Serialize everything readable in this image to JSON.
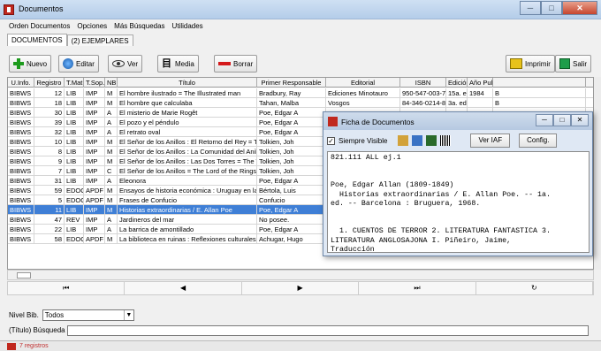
{
  "window": {
    "title": "Documentos"
  },
  "menu": [
    "Orden Documentos",
    "Opciones",
    "Más Búsquedas",
    "Utilidades"
  ],
  "tabs": [
    "DOCUMENTOS",
    "(2) EJEMPLARES"
  ],
  "toolbar": {
    "nuevo": "Nuevo",
    "editar": "Editar",
    "ver": "Ver",
    "media": "Media",
    "borrar": "Borrar",
    "imprimir": "Imprimir",
    "salir": "Salir"
  },
  "table": {
    "headers": [
      "U.Info.",
      "Registro",
      "T.Mat.",
      "T.Sop.",
      "NB.",
      "Título",
      "Primer Responsable",
      "Editorial",
      "ISBN",
      "Edición",
      "Año Pub.",
      ""
    ],
    "rows": [
      [
        "BIBWS",
        "12",
        "LIB",
        "IMP",
        "M",
        "El hombre ilustrado = The Illustrated man",
        "Bradbury, Ray",
        "Ediciones Minotauro",
        "950-547-003-7",
        "15a. ed.",
        "1984",
        "B"
      ],
      [
        "BIBWS",
        "18",
        "LIB",
        "IMP",
        "M",
        "El hombre que calculaba",
        "Tahan, Malba",
        "Vosgos",
        "84-346-0214-8",
        "3a. ed.",
        "",
        "B"
      ],
      [
        "BIBWS",
        "30",
        "LIB",
        "IMP",
        "A",
        "El misterio de Marie Rogêt",
        "Poe, Edgar A",
        "",
        "",
        "",
        "",
        ""
      ],
      [
        "BIBWS",
        "39",
        "LIB",
        "IMP",
        "A",
        "El pozo y el péndulo",
        "Poe, Edgar A",
        "",
        "",
        "",
        "",
        ""
      ],
      [
        "BIBWS",
        "32",
        "LIB",
        "IMP",
        "A",
        "El retrato oval",
        "Poe, Edgar A",
        "",
        "",
        "",
        "",
        ""
      ],
      [
        "BIBWS",
        "10",
        "LIB",
        "IMP",
        "M",
        "El Señor de los Anillos : El Retorno del Rey = The Ret",
        "Tolkien, Joh",
        "",
        "",
        "",
        "",
        ""
      ],
      [
        "BIBWS",
        "8",
        "LIB",
        "IMP",
        "M",
        "El Señor de los Anillos : La Comunidad del Anillo = The",
        "Tolkien, Joh",
        "",
        "",
        "",
        "",
        ""
      ],
      [
        "BIBWS",
        "9",
        "LIB",
        "IMP",
        "M",
        "El Señor de los Anillos : Las Dos Torres = The Two To",
        "Tolkien, Joh",
        "",
        "",
        "",
        "",
        ""
      ],
      [
        "BIBWS",
        "7",
        "LIB",
        "IMP",
        "C",
        "El Señor de los Anillos = The Lord of the Rings",
        "Tolkien, Joh",
        "",
        "",
        "",
        "",
        ""
      ],
      [
        "BIBWS",
        "31",
        "LIB",
        "IMP",
        "A",
        "Eleonora",
        "Poe, Edgar A",
        "",
        "",
        "",
        "",
        ""
      ],
      [
        "BIBWS",
        "59",
        "EDOC",
        "APDF",
        "M",
        "Ensayos de historia económica : Uruguay en la reg",
        "Bértola, Luis",
        "",
        "",
        "",
        "",
        ""
      ],
      [
        "BIBWS",
        "5",
        "EDOC",
        "APDF",
        "M",
        "Frases de Confucio",
        "Confucio",
        "",
        "",
        "",
        "",
        ""
      ],
      [
        "BIBWS",
        "11",
        "LIB",
        "IMP",
        "M",
        "Historias extraordinarias / E. Allan Poe",
        "Poe, Edgar A",
        "",
        "",
        "",
        "",
        ""
      ],
      [
        "BIBWS",
        "47",
        "REV",
        "IMP",
        "A",
        "Jardineros del mar",
        "No posee.",
        "",
        "",
        "",
        "",
        ""
      ],
      [
        "BIBWS",
        "22",
        "LIB",
        "IMP",
        "A",
        "La barrica de amontillado",
        "Poe, Edgar A",
        "",
        "",
        "",
        "",
        ""
      ],
      [
        "BIBWS",
        "58",
        "EDOC",
        "APDF",
        "M",
        "La biblioteca en ruinas : Reflexiones culturales des",
        "Achugar, Hugo",
        "Trilce",
        "9974-32-076-3",
        "1a. ed.",
        "1994",
        "M"
      ]
    ]
  },
  "nav": [
    "⏮",
    "◀",
    "▶",
    "⏭",
    "↻"
  ],
  "filters": {
    "nivel_label": "Nivel Bib.",
    "nivel_value": "Todos",
    "busqueda_label": "(Título) Búsqueda"
  },
  "status": "7 registros",
  "ficha": {
    "title": "Ficha de Documentos",
    "siempre_visible": "Siempre Visible",
    "ver_iaf": "Ver IAF",
    "config": "Config.",
    "body": "821.111 ALL ej.1\n\n\nPoe, Edgar Allan (1809-1849)\n  Historias extraordinarias / E. Allan Poe. -- 1a.\ned. -- Barcelona : Bruguera, 1968.\n\n\n  1. CUENTOS DE TERROR 2. LITERATURA FANTASTICA 3.\nLITERATURA ANGLOSAJONA I. Piñeiro, Jaime,\nTraducción"
  }
}
